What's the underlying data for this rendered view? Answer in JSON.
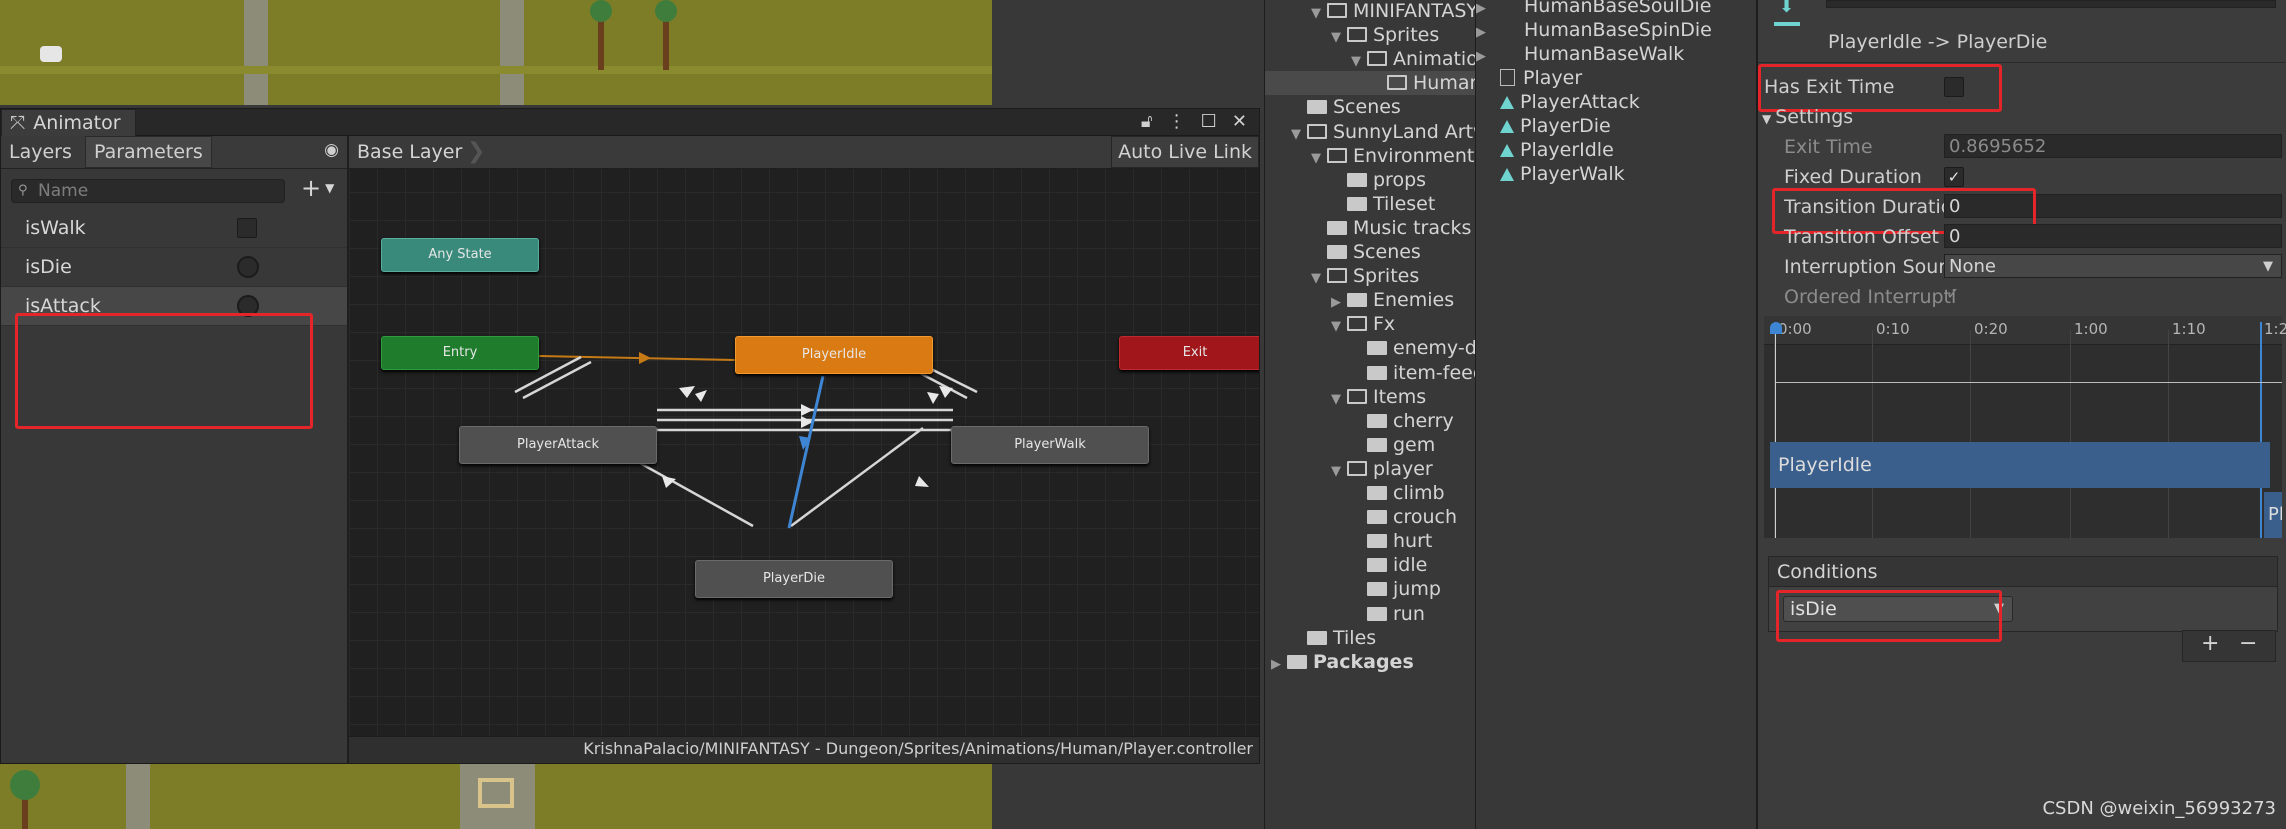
{
  "animator": {
    "tab_title": "Animator",
    "left_tabs": [
      "Layers",
      "Parameters"
    ],
    "search_placeholder": "Name",
    "params": [
      {
        "name": "isWalk",
        "type": "bool"
      },
      {
        "name": "isDie",
        "type": "trigger"
      },
      {
        "name": "isAttack",
        "type": "trigger"
      }
    ],
    "breadcrumb": "Base Layer",
    "auto_live_link": "Auto Live Link",
    "nodes": {
      "any_state": "Any State",
      "entry": "Entry",
      "exit": "Exit",
      "player_idle": "PlayerIdle",
      "player_attack": "PlayerAttack",
      "player_walk": "PlayerWalk",
      "player_die": "PlayerDie"
    },
    "footer_path": "KrishnaPalacio/MINIFANTASY - Dungeon/Sprites/Animations/Human/Player.controller"
  },
  "project": {
    "tree": [
      {
        "label": "MINIFANTASY",
        "depth": 2,
        "arrow": "down",
        "open": true
      },
      {
        "label": "Sprites",
        "depth": 3,
        "arrow": "down",
        "open": true
      },
      {
        "label": "Animations",
        "depth": 4,
        "arrow": "down",
        "open": true
      },
      {
        "label": "Human",
        "depth": 5,
        "arrow": "",
        "open": true,
        "selected": true
      },
      {
        "label": "Scenes",
        "depth": 1,
        "arrow": "",
        "open": false
      },
      {
        "label": "SunnyLand Artwork",
        "depth": 1,
        "arrow": "down",
        "open": true
      },
      {
        "label": "Environment",
        "depth": 2,
        "arrow": "down",
        "open": true
      },
      {
        "label": "props",
        "depth": 3,
        "arrow": "",
        "open": false
      },
      {
        "label": "Tileset",
        "depth": 3,
        "arrow": "",
        "open": false
      },
      {
        "label": "Music tracks",
        "depth": 2,
        "arrow": "",
        "open": false
      },
      {
        "label": "Scenes",
        "depth": 2,
        "arrow": "",
        "open": false
      },
      {
        "label": "Sprites",
        "depth": 2,
        "arrow": "down",
        "open": true
      },
      {
        "label": "Enemies",
        "depth": 3,
        "arrow": "right",
        "open": false
      },
      {
        "label": "Fx",
        "depth": 3,
        "arrow": "down",
        "open": true
      },
      {
        "label": "enemy-death",
        "depth": 4,
        "arrow": "",
        "open": false
      },
      {
        "label": "item-feedback",
        "depth": 4,
        "arrow": "",
        "open": false
      },
      {
        "label": "Items",
        "depth": 3,
        "arrow": "down",
        "open": true
      },
      {
        "label": "cherry",
        "depth": 4,
        "arrow": "",
        "open": false
      },
      {
        "label": "gem",
        "depth": 4,
        "arrow": "",
        "open": false
      },
      {
        "label": "player",
        "depth": 3,
        "arrow": "down",
        "open": true
      },
      {
        "label": "climb",
        "depth": 4,
        "arrow": "",
        "open": false
      },
      {
        "label": "crouch",
        "depth": 4,
        "arrow": "",
        "open": false
      },
      {
        "label": "hurt",
        "depth": 4,
        "arrow": "",
        "open": false
      },
      {
        "label": "idle",
        "depth": 4,
        "arrow": "",
        "open": false
      },
      {
        "label": "jump",
        "depth": 4,
        "arrow": "",
        "open": false
      },
      {
        "label": "run",
        "depth": 4,
        "arrow": "",
        "open": false
      },
      {
        "label": "Tiles",
        "depth": 1,
        "arrow": "",
        "open": false
      },
      {
        "label": "Packages",
        "depth": 0,
        "arrow": "right",
        "open": false,
        "bold": true
      }
    ],
    "assets": [
      {
        "label": "HumanBaseSoulDie",
        "icon": "arrow"
      },
      {
        "label": "HumanBaseSpinDie",
        "icon": "arrow"
      },
      {
        "label": "HumanBaseWalk",
        "icon": "arrow"
      },
      {
        "label": "Player",
        "icon": "file"
      },
      {
        "label": "PlayerAttack",
        "icon": "anim"
      },
      {
        "label": "PlayerDie",
        "icon": "anim"
      },
      {
        "label": "PlayerIdle",
        "icon": "anim"
      },
      {
        "label": "PlayerWalk",
        "icon": "anim"
      }
    ]
  },
  "inspector": {
    "transition_title": "PlayerIdle -> PlayerDie",
    "has_exit_time_label": "Has Exit Time",
    "has_exit_time": false,
    "settings_label": "Settings",
    "exit_time_label": "Exit Time",
    "exit_time_value": "0.8695652",
    "fixed_duration_label": "Fixed Duration",
    "fixed_duration": true,
    "transition_duration_label": "Transition Duratio",
    "transition_duration_value": "0",
    "transition_offset_label": "Transition Offset",
    "transition_offset_value": "0",
    "interruption_source_label": "Interruption Sourc",
    "interruption_source_value": "None",
    "ordered_interruption_label": "Ordered Interrupti",
    "ordered_interruption": true,
    "timeline_ticks": [
      "0:00",
      "0:10",
      "0:20",
      "1:00",
      "1:10",
      "1:2"
    ],
    "timeline_track_from": "PlayerIdle",
    "timeline_track_to": "Pl",
    "conditions_label": "Conditions",
    "condition_param": "isDie",
    "plus_label": "+",
    "minus_label": "−"
  },
  "watermark": "CSDN @weixin_56993273",
  "colors": {
    "highlight": "#e4262b",
    "entry": "#1e7c2c",
    "any_state": "#3a8a7c",
    "exit": "#a0161a",
    "default_state": "#d97a12",
    "state": "#505050",
    "active_transition": "#3e86d4"
  }
}
